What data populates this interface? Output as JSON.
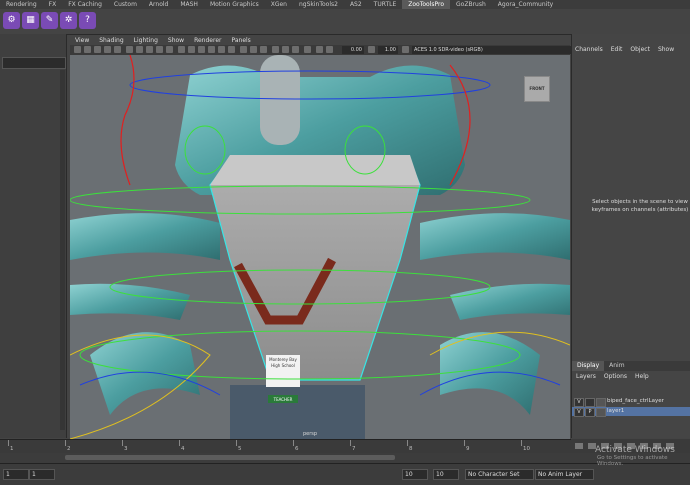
{
  "shelf_tabs": [
    "Rendering",
    "FX",
    "FX Caching",
    "Custom",
    "Arnold",
    "MASH",
    "Motion Graphics",
    "XGen",
    "ngSkinTools2",
    "AS2",
    "TURTLE",
    "ZooToolsPro",
    "GoZBrush",
    "Agora_Community"
  ],
  "active_shelf_tab": "ZooToolsPro",
  "viewport_menu": [
    "View",
    "Shading",
    "Lighting",
    "Show",
    "Renderer",
    "Panels"
  ],
  "viewport_toolbar": {
    "field1": "0.00",
    "field2": "1.00",
    "color_space": "ACES 1.0 SDR-video (sRGB)"
  },
  "view_cube_label": "FRONT",
  "camera_label": "persp",
  "badge": {
    "line1": "Monterey Bay",
    "line2": "High School",
    "bottom": "TEACHER"
  },
  "channel_box": {
    "menu": [
      "Channels",
      "Edit",
      "Object",
      "Show"
    ],
    "message_line1": "Select objects in the scene to view",
    "message_line2": "keyframes on channels (attributes)"
  },
  "layer_editor": {
    "tabs": [
      "Display",
      "Anim"
    ],
    "active_tab": "Display",
    "menu": [
      "Layers",
      "Options",
      "Help"
    ],
    "layers": [
      {
        "v": "V",
        "p": "",
        "name": "biped_face_ctrlLayer"
      },
      {
        "v": "V",
        "p": "P",
        "name": "layer1"
      }
    ]
  },
  "timeline": {
    "ticks": [
      "1",
      "2",
      "3",
      "4",
      "5",
      "6",
      "7",
      "8",
      "9",
      "10"
    ]
  },
  "range": {
    "start": "1",
    "end": "10",
    "anim_start": "10",
    "anim_end": "10"
  },
  "status": {
    "character_set": "No Character Set",
    "anim_layer": "No Anim Layer"
  },
  "watermark": {
    "line1": "Activate Windows",
    "line2": "Go to Settings to activate Windows."
  },
  "colors": {
    "accent_purple": "#7a4bb5",
    "mesh_cyan": "#4fb8b8",
    "ctrl_green": "#3ce03c",
    "ctrl_red": "#e02020",
    "ctrl_blue": "#2040e0",
    "ctrl_yellow": "#e0c020",
    "active_tab": "#5a5a5a"
  }
}
